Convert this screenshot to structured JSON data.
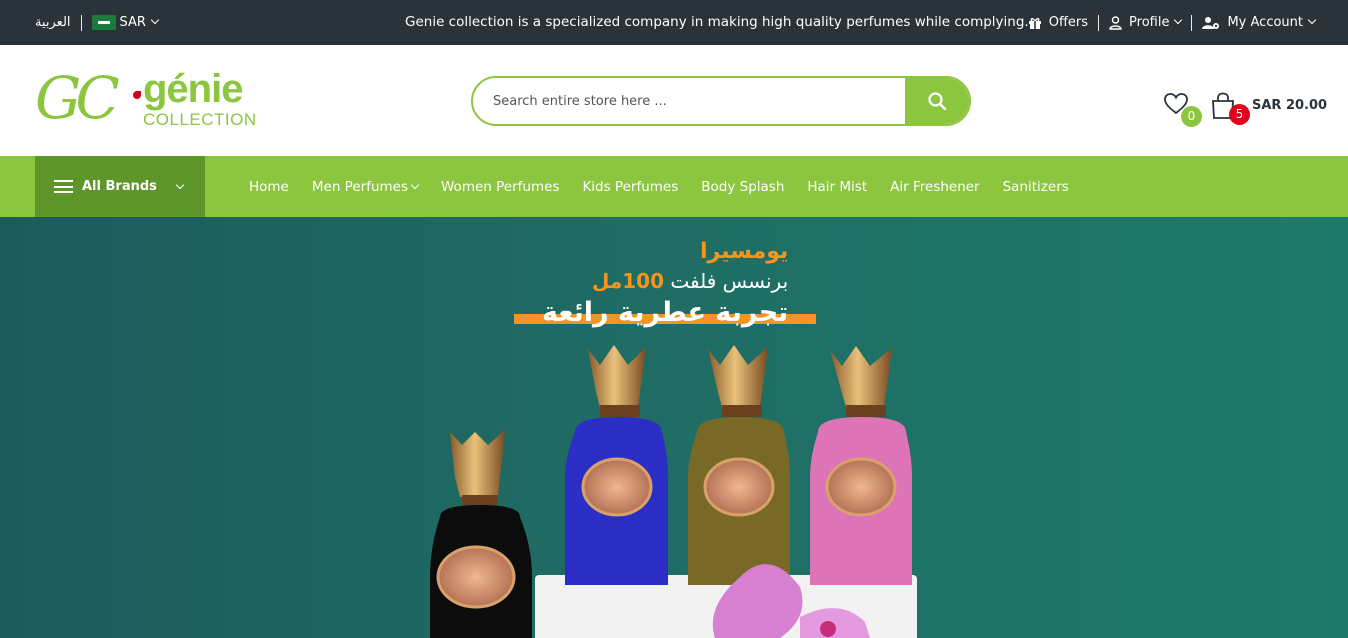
{
  "topbar": {
    "language": "العربية",
    "currency": "SAR",
    "announcement": "Genie collection is a specialized company in making high quality perfumes while complying...",
    "offers": "Offers",
    "profile": "Profile",
    "my_account": "My Account"
  },
  "header": {
    "logo_gc": "GC",
    "logo_genie": "génie",
    "logo_collection": "COLLECTION",
    "search_placeholder": "Search entire store here ...",
    "wishlist_count": "0",
    "cart_count": "5",
    "cart_total": "SAR 20.00"
  },
  "nav": {
    "brands_label": "All Brands",
    "items": [
      "Home",
      "Men Perfumes",
      "Women Perfumes",
      "Kids Perfumes",
      "Body Splash",
      "Hair Mist",
      "Air Freshener",
      "Sanitizers"
    ]
  },
  "hero": {
    "line1": "يومسيرا",
    "line2_prefix": "برنسس فلفت ",
    "line2_number": "100مل",
    "line3": "تجربة عطرية رائعة"
  },
  "colors": {
    "brand_green": "#8cc63f",
    "dark_green": "#5e962a",
    "topbar": "#2a3339",
    "orange": "#f7941d",
    "badge_red": "#e3001b"
  }
}
